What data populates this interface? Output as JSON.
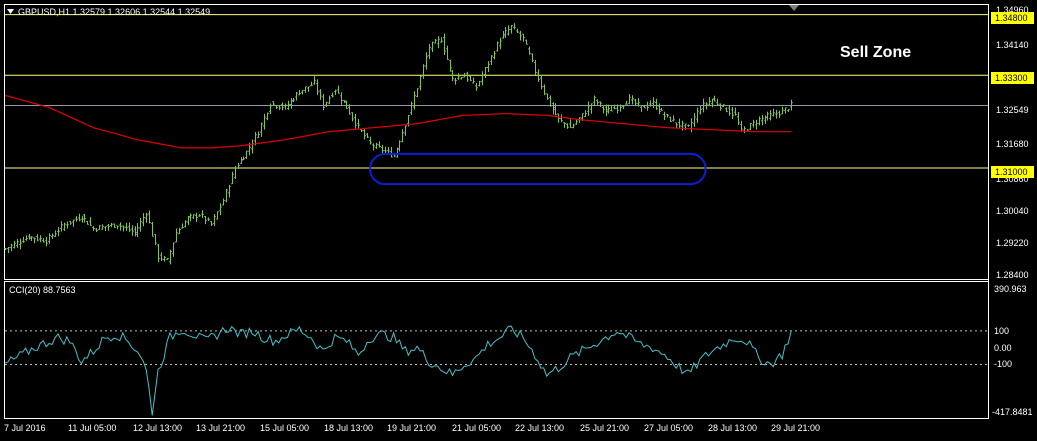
{
  "chart_data": [
    {
      "type": "ohlc",
      "header": "GBPUSD,H1  1.32579 1.32606 1.32544 1.32549",
      "annotation": "Sell Zone",
      "yaxis_ticks": [
        "1.34960",
        "1.34140",
        "1.31680",
        "1.30860",
        "1.30040",
        "1.29220",
        "1.28400"
      ],
      "ylim": [
        1.2825,
        1.3504
      ],
      "levels": [
        {
          "value": 1.348,
          "label": "1.34800",
          "color": "#ffff80"
        },
        {
          "value": 1.333,
          "label": "1.33300",
          "color": "#ffff80"
        },
        {
          "value": 1.31,
          "label": "1.31000",
          "color": "#ffff80"
        }
      ],
      "current_price": {
        "value": 1.32549,
        "label": "1.32549"
      },
      "xaxis_ticks": [
        "7 Jul 2016",
        "11 Jul 05:00",
        "12 Jul 13:00",
        "13 Jul 21:00",
        "15 Jul 05:00",
        "18 Jul 13:00",
        "19 Jul 21:00",
        "21 Jul 05:00",
        "22 Jul 13:00",
        "25 Jul 21:00",
        "27 Jul 05:00",
        "28 Jul 13:00",
        "29 Jul 21:00"
      ],
      "n_bars": 268,
      "close_path": [
        [
          0,
          1.29
        ],
        [
          8,
          1.293
        ],
        [
          14,
          1.292
        ],
        [
          20,
          1.296
        ],
        [
          26,
          1.298
        ],
        [
          30,
          1.295
        ],
        [
          38,
          1.296
        ],
        [
          44,
          1.294
        ],
        [
          48,
          1.299
        ],
        [
          52,
          1.288
        ],
        [
          55,
          1.287
        ],
        [
          58,
          1.294
        ],
        [
          62,
          1.2975
        ],
        [
          66,
          1.2985
        ],
        [
          70,
          1.296
        ],
        [
          74,
          1.302
        ],
        [
          78,
          1.31
        ],
        [
          82,
          1.314
        ],
        [
          86,
          1.319
        ],
        [
          90,
          1.326
        ],
        [
          95,
          1.325
        ],
        [
          100,
          1.329
        ],
        [
          105,
          1.331
        ],
        [
          108,
          1.3255
        ],
        [
          112,
          1.3295
        ],
        [
          116,
          1.325
        ],
        [
          120,
          1.32
        ],
        [
          124,
          1.316
        ],
        [
          128,
          1.3145
        ],
        [
          132,
          1.313
        ],
        [
          136,
          1.321
        ],
        [
          140,
          1.33
        ],
        [
          144,
          1.34
        ],
        [
          148,
          1.342
        ],
        [
          152,
          1.332
        ],
        [
          156,
          1.333
        ],
        [
          160,
          1.33
        ],
        [
          164,
          1.336
        ],
        [
          168,
          1.342
        ],
        [
          172,
          1.345
        ],
        [
          176,
          1.342
        ],
        [
          180,
          1.334
        ],
        [
          184,
          1.327
        ],
        [
          188,
          1.322
        ],
        [
          192,
          1.32
        ],
        [
          196,
          1.323
        ],
        [
          200,
          1.327
        ],
        [
          204,
          1.324
        ],
        [
          208,
          1.325
        ],
        [
          212,
          1.327
        ],
        [
          216,
          1.325
        ],
        [
          220,
          1.326
        ],
        [
          224,
          1.323
        ],
        [
          228,
          1.321
        ],
        [
          232,
          1.32
        ],
        [
          236,
          1.325
        ],
        [
          240,
          1.327
        ],
        [
          244,
          1.325
        ],
        [
          248,
          1.323
        ],
        [
          250,
          1.319
        ],
        [
          252,
          1.32
        ],
        [
          256,
          1.322
        ],
        [
          260,
          1.323
        ],
        [
          264,
          1.324
        ],
        [
          267,
          1.3255
        ]
      ],
      "ma_path": [
        [
          0,
          1.328
        ],
        [
          15,
          1.325
        ],
        [
          30,
          1.32
        ],
        [
          45,
          1.317
        ],
        [
          60,
          1.315
        ],
        [
          70,
          1.315
        ],
        [
          80,
          1.3155
        ],
        [
          95,
          1.317
        ],
        [
          110,
          1.319
        ],
        [
          125,
          1.32
        ],
        [
          140,
          1.321
        ],
        [
          155,
          1.323
        ],
        [
          170,
          1.3235
        ],
        [
          185,
          1.323
        ],
        [
          195,
          1.322
        ],
        [
          210,
          1.321
        ],
        [
          225,
          1.32
        ],
        [
          240,
          1.3195
        ],
        [
          255,
          1.319
        ],
        [
          267,
          1.319
        ]
      ],
      "ellipse": {
        "x_from": 124,
        "x_to": 238,
        "y_low": 1.306,
        "y_high": 1.3135,
        "color": "#0a1fd4"
      },
      "ma_color": "#e00000",
      "bar_color": "#7fc44f"
    },
    {
      "type": "line",
      "header": "CCI(20) 88.7563",
      "yaxis_ticks": [
        "390.963",
        "100",
        "0.00",
        "-100",
        "-417.8481"
      ],
      "ylim": [
        -417.8481,
        390.963
      ],
      "dotted_levels": [
        100,
        -100
      ],
      "line_color": "#45c1c9",
      "path": [
        [
          0,
          -100
        ],
        [
          6,
          -40
        ],
        [
          10,
          0
        ],
        [
          14,
          30
        ],
        [
          18,
          60
        ],
        [
          22,
          40
        ],
        [
          26,
          -80
        ],
        [
          30,
          -20
        ],
        [
          34,
          60
        ],
        [
          38,
          80
        ],
        [
          42,
          40
        ],
        [
          46,
          -40
        ],
        [
          48,
          -140
        ],
        [
          50,
          -380
        ],
        [
          52,
          -140
        ],
        [
          56,
          60
        ],
        [
          60,
          110
        ],
        [
          64,
          80
        ],
        [
          68,
          40
        ],
        [
          72,
          80
        ],
        [
          76,
          120
        ],
        [
          80,
          80
        ],
        [
          84,
          100
        ],
        [
          88,
          60
        ],
        [
          92,
          40
        ],
        [
          96,
          80
        ],
        [
          100,
          110
        ],
        [
          104,
          60
        ],
        [
          108,
          -20
        ],
        [
          112,
          60
        ],
        [
          116,
          40
        ],
        [
          120,
          -40
        ],
        [
          124,
          60
        ],
        [
          128,
          80
        ],
        [
          132,
          60
        ],
        [
          136,
          -20
        ],
        [
          140,
          0
        ],
        [
          144,
          -80
        ],
        [
          148,
          -120
        ],
        [
          152,
          -160
        ],
        [
          156,
          -100
        ],
        [
          160,
          -60
        ],
        [
          164,
          20
        ],
        [
          168,
          60
        ],
        [
          172,
          110
        ],
        [
          176,
          60
        ],
        [
          180,
          -40
        ],
        [
          184,
          -160
        ],
        [
          188,
          -120
        ],
        [
          192,
          -60
        ],
        [
          196,
          -20
        ],
        [
          200,
          20
        ],
        [
          204,
          60
        ],
        [
          208,
          100
        ],
        [
          212,
          60
        ],
        [
          216,
          20
        ],
        [
          220,
          0
        ],
        [
          224,
          -40
        ],
        [
          228,
          -100
        ],
        [
          232,
          -160
        ],
        [
          236,
          -80
        ],
        [
          240,
          -20
        ],
        [
          244,
          20
        ],
        [
          248,
          60
        ],
        [
          252,
          40
        ],
        [
          256,
          -60
        ],
        [
          260,
          -100
        ],
        [
          264,
          -40
        ],
        [
          267,
          88.7563
        ]
      ]
    }
  ]
}
